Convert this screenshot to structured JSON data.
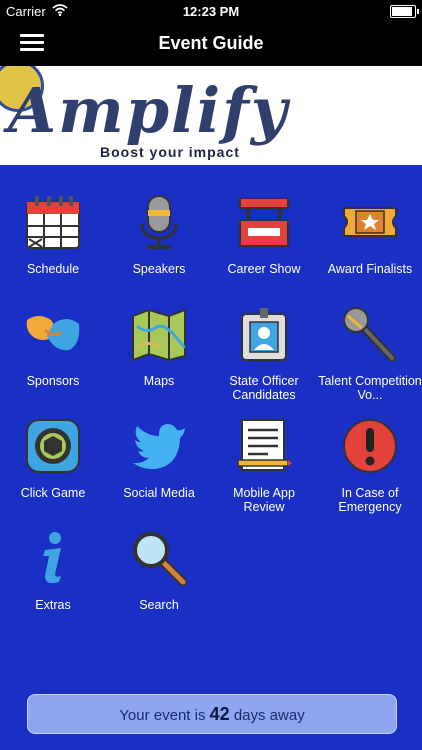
{
  "status": {
    "carrier": "Carrier",
    "time": "12:23 PM"
  },
  "nav": {
    "title": "Event Guide"
  },
  "banner": {
    "logo_text": "Amplify",
    "tagline": "Boost your impact"
  },
  "tiles": [
    {
      "label": "Schedule",
      "icon": "calendar-icon"
    },
    {
      "label": "Speakers",
      "icon": "microphone-icon"
    },
    {
      "label": "Career Show",
      "icon": "booth-icon"
    },
    {
      "label": "Award Finalists",
      "icon": "ticket-star-icon"
    },
    {
      "label": "Sponsors",
      "icon": "handshake-icon"
    },
    {
      "label": "Maps",
      "icon": "map-icon"
    },
    {
      "label": "State Officer Candidates",
      "icon": "id-badge-icon"
    },
    {
      "label": "Talent Competition Vo...",
      "icon": "handheld-mic-icon"
    },
    {
      "label": "Click Game",
      "icon": "camera-shutter-icon"
    },
    {
      "label": "Social Media",
      "icon": "twitter-bird-icon"
    },
    {
      "label": "Mobile App Review",
      "icon": "notepad-pencil-icon"
    },
    {
      "label": "In Case of Emergency",
      "icon": "exclamation-icon"
    },
    {
      "label": "Extras",
      "icon": "info-icon"
    },
    {
      "label": "Search",
      "icon": "magnifier-icon"
    }
  ],
  "footer": {
    "prefix": "Your event is",
    "days": "42",
    "suffix": "days away"
  }
}
